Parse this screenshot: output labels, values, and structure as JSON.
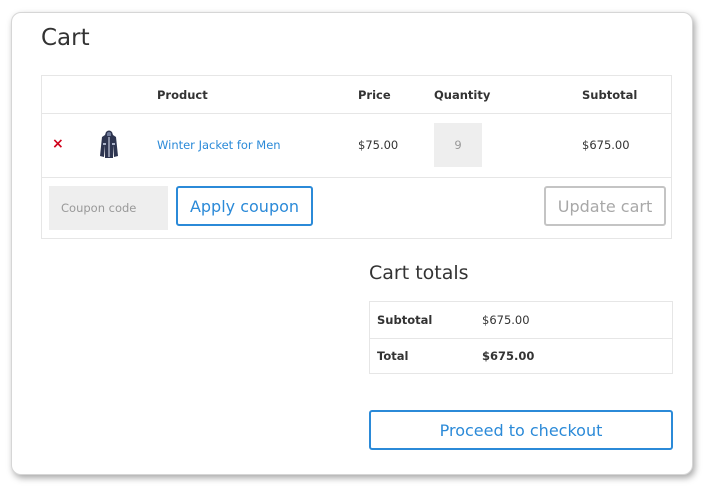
{
  "page": {
    "title": "Cart"
  },
  "cart_table": {
    "headers": {
      "product": "Product",
      "price": "Price",
      "quantity": "Quantity",
      "subtotal": "Subtotal"
    },
    "items": [
      {
        "remove_icon": "close-icon",
        "remove_symbol": "×",
        "thumbnail": "winter-jacket-thumbnail",
        "name": "Winter Jacket for Men",
        "price": "$75.00",
        "quantity": "9",
        "subtotal": "$675.00"
      }
    ],
    "coupon": {
      "placeholder": "Coupon code",
      "value": "",
      "apply_label": "Apply coupon"
    },
    "update_label": "Update cart"
  },
  "totals": {
    "title": "Cart totals",
    "subtotal_label": "Subtotal",
    "subtotal_value": "$675.00",
    "total_label": "Total",
    "total_value": "$675.00"
  },
  "checkout": {
    "label": "Proceed to checkout"
  },
  "colors": {
    "accent": "#2b8ad8",
    "remove": "#d0021b",
    "disabled_button": "#a8a8a8",
    "input_background": "#eeeeee"
  }
}
